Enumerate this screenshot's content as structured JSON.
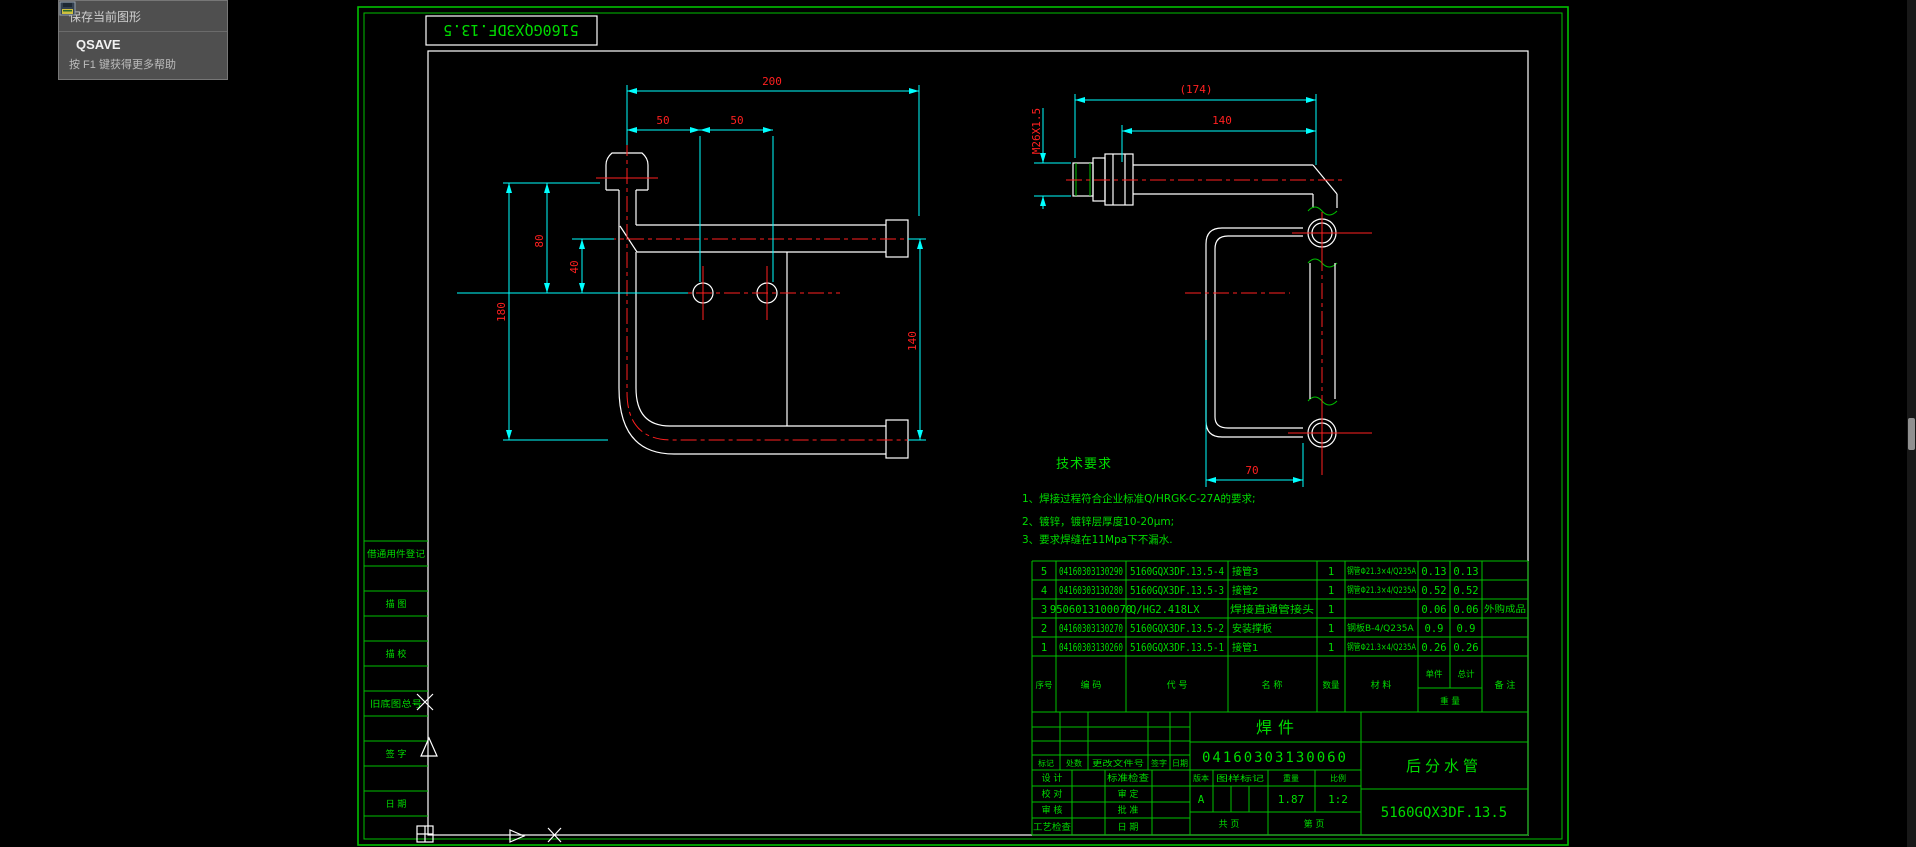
{
  "tooltip": {
    "title": "保存当前图形",
    "command": "QSAVE",
    "hint": "按 F1 键获得更多帮助"
  },
  "stamp": {
    "code": "5160GQX3DF.13.5"
  },
  "front": {
    "dim200": "200",
    "dim50a": "50",
    "dim50b": "50",
    "dim180": "180",
    "dim80": "80",
    "dim40": "40",
    "dim140": "140"
  },
  "side": {
    "dim174": "(174)",
    "dim140": "140",
    "thread": "M26X1.5",
    "dim70": "70"
  },
  "tech": {
    "title": "技术要求",
    "l1": "1、焊接过程符合企业标准Q/HRGK-C-27A的要求;",
    "l2": "2、镀锌，镀锌层厚度10-20μm;",
    "l3": "3、要求焊缝在11Mpa下不漏水."
  },
  "pt": {
    "h_seq": "序号",
    "h_code": "编  码",
    "h_dwg": "代  号",
    "h_name": "名  称",
    "h_qty": "数量",
    "h_mat": "材  料",
    "h_unit": "单件",
    "h_total": "总计",
    "h_weight": "重  量",
    "h_remark": "备  注",
    "rows": [
      {
        "seq": "5",
        "code": "04160303130290",
        "dwg": "5160GQX3DF.13.5-4",
        "name": "接管3",
        "qty": "1",
        "mat": "钢管Φ21.3×4/Q235A",
        "unit": "0.13",
        "total": "0.13",
        "remark": ""
      },
      {
        "seq": "4",
        "code": "04160303130280",
        "dwg": "5160GQX3DF.13.5-3",
        "name": "接管2",
        "qty": "1",
        "mat": "钢管Φ21.3×4/Q235A",
        "unit": "0.52",
        "total": "0.52",
        "remark": ""
      },
      {
        "seq": "3",
        "code": "9506013100070",
        "dwg": "Q/HG2.418LX",
        "name": "焊接直通管接头",
        "qty": "1",
        "mat": "",
        "unit": "0.06",
        "total": "0.06",
        "remark": "外购成品"
      },
      {
        "seq": "2",
        "code": "04160303130270",
        "dwg": "5160GQX3DF.13.5-2",
        "name": "安装撑板",
        "qty": "1",
        "mat": "钢板B-4/Q235A",
        "unit": "0.9",
        "total": "0.9",
        "remark": ""
      },
      {
        "seq": "1",
        "code": "04160303130260",
        "dwg": "5160GQX3DF.13.5-1",
        "name": "接管1",
        "qty": "1",
        "mat": "钢管Φ21.3×4/Q235A",
        "unit": "0.26",
        "total": "0.26",
        "remark": ""
      }
    ]
  },
  "tb": {
    "type": "焊件",
    "code": "04160303130060",
    "name": "后分水管",
    "dwg": "5160GQX3DF.13.5",
    "rev": [
      "标记",
      "处数",
      "更改文件号",
      "签字",
      "日期"
    ],
    "sig": [
      {
        "l": "设 计",
        "r": "标准检查"
      },
      {
        "l": "校 对",
        "r": "审 定"
      },
      {
        "l": "审 核",
        "r": "批 准"
      },
      {
        "l": "工艺检查",
        "r": "日 期"
      }
    ],
    "meta": {
      "version_label": "版本",
      "mark_label": "图样标记",
      "weight_label": "重量",
      "scale_label": "比例",
      "version": "A",
      "weight": "1.87",
      "scale": "1:2",
      "total_pages": "共  页",
      "page": "第  页"
    }
  },
  "strip": [
    "借通用件登记",
    "描 图",
    "描 校",
    "旧底图总号",
    "签 字",
    "日 期"
  ],
  "colors": {
    "line_green": "#00c000",
    "text_green": "#00dc00",
    "dim_cyan": "#00ffff",
    "dim_red": "#ff2020",
    "geometry_white": "#ffffff",
    "tooltip_bg": "#4f4f4f"
  }
}
